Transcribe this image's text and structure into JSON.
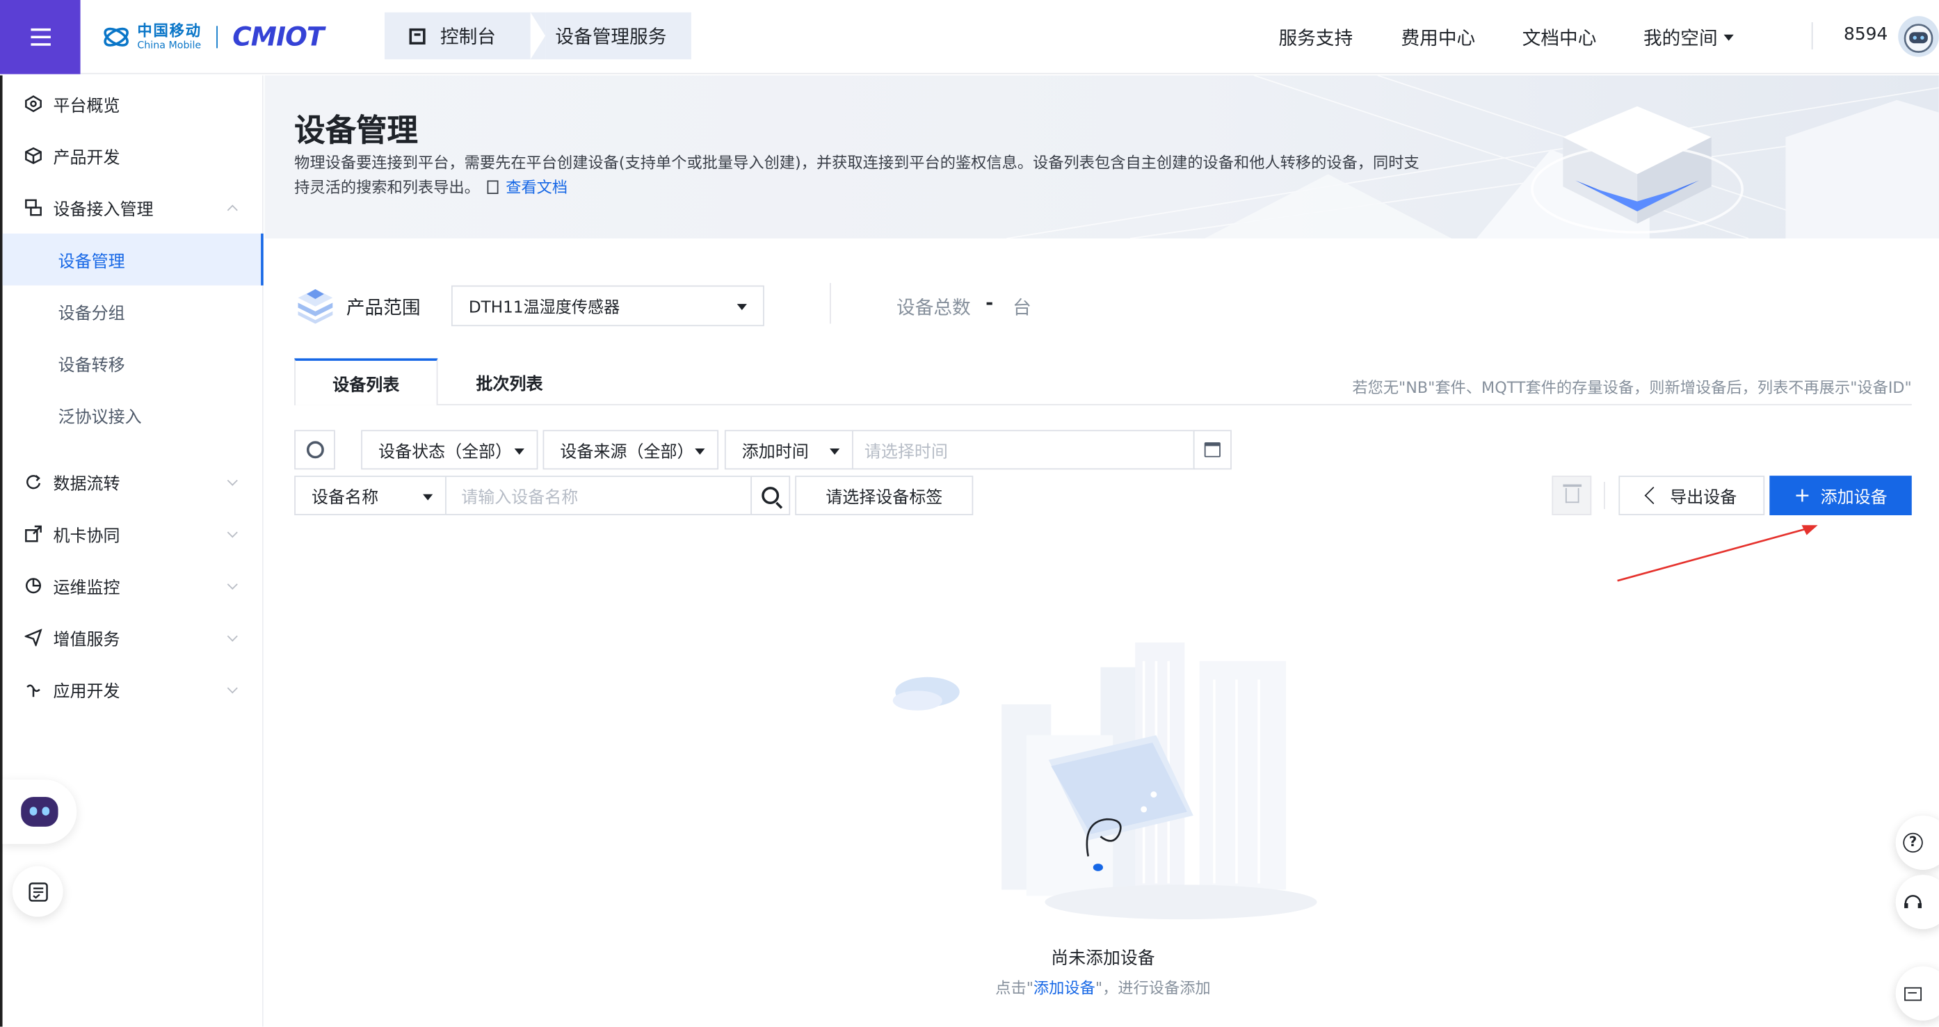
{
  "header": {
    "logo_cn": "中国移动",
    "logo_en": "China Mobile",
    "brand": "CMIOT",
    "breadcrumb": [
      "控制台",
      "设备管理服务"
    ],
    "nav": [
      {
        "label": "服务支持"
      },
      {
        "label": "费用中心"
      },
      {
        "label": "文档中心"
      },
      {
        "label": "我的空间"
      }
    ],
    "user_id": "8594"
  },
  "sidebar": {
    "items": [
      {
        "label": "平台概览",
        "icon": "overview-icon"
      },
      {
        "label": "产品开发",
        "icon": "cube-icon"
      },
      {
        "label": "设备接入管理",
        "icon": "device-access-icon",
        "expanded": true
      },
      {
        "label": "数据流转",
        "icon": "data-flow-icon"
      },
      {
        "label": "机卡协同",
        "icon": "card-link-icon"
      },
      {
        "label": "运维监控",
        "icon": "pie-chart-icon"
      },
      {
        "label": "增值服务",
        "icon": "send-icon"
      },
      {
        "label": "应用开发",
        "icon": "app-dev-icon"
      }
    ],
    "sub_items": [
      {
        "label": "设备管理",
        "active": true
      },
      {
        "label": "设备分组"
      },
      {
        "label": "设备转移"
      },
      {
        "label": "泛协议接入"
      }
    ]
  },
  "banner": {
    "title": "设备管理",
    "desc": "物理设备要连接到平台，需要先在平台创建设备(支持单个或批量导入创建)，并获取连接到平台的鉴权信息。设备列表包含自主创建的设备和他人转移的设备，同时支持灵活的搜索和列表导出。",
    "doc_link": "查看文档"
  },
  "product": {
    "label": "产品范围",
    "selected": "DTH11温湿度传感器",
    "total_label": "设备总数",
    "total_value": "-",
    "total_unit": "台"
  },
  "tabs": [
    {
      "label": "设备列表",
      "active": true
    },
    {
      "label": "批次列表"
    }
  ],
  "tab_note": "若您无\"NB\"套件、MQTT套件的存量设备，则新增设备后，列表不再展示\"设备ID\"",
  "filters": {
    "status": "设备状态（全部）",
    "source": "设备来源（全部）",
    "time_type": "添加时间",
    "time_placeholder": "请选择时间",
    "name_type": "设备名称",
    "name_placeholder": "请输入设备名称",
    "tag_placeholder": "请选择设备标签"
  },
  "actions": {
    "export": "导出设备",
    "add": "添加设备"
  },
  "empty": {
    "title": "尚未添加设备",
    "sub_prefix": "点击\"",
    "sub_link": "添加设备",
    "sub_suffix": "\"，进行设备添加"
  },
  "colors": {
    "accent": "#1667e6",
    "menu_bg": "#5b3fd4",
    "arrow": "#e5322d"
  }
}
